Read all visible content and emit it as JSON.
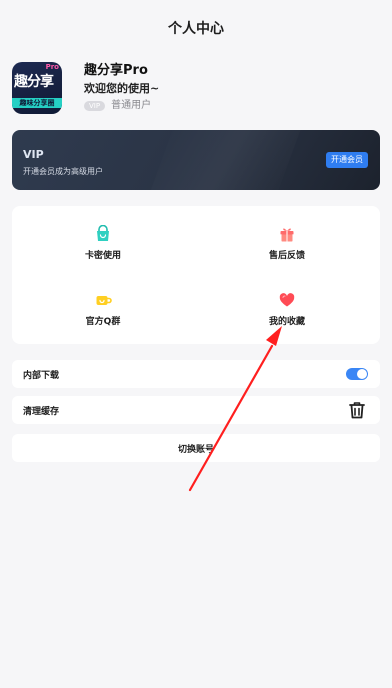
{
  "header": {
    "title": "个人中心"
  },
  "profile": {
    "logo_text": "趣分享",
    "logo_badge": "Pro",
    "logo_strip": "趣味分享圈",
    "name": "趣分享Pro",
    "greeting": "欢迎您的使用~",
    "vip_pill": "VIP",
    "level": "普通用户"
  },
  "vip_card": {
    "title": "VIP",
    "subtitle": "开通会员成为高级用户",
    "button": "开通会员"
  },
  "grid": {
    "items": [
      {
        "label": "卡密使用",
        "icon": "shopping-bag-icon",
        "color": "#2fd0c1"
      },
      {
        "label": "售后反馈",
        "icon": "gift-icon",
        "color": "#ff6b6b"
      },
      {
        "label": "官方Q群",
        "icon": "cup-icon",
        "color": "#ffcf22"
      },
      {
        "label": "我的收藏",
        "icon": "heart-icon",
        "color": "#ff4b55"
      }
    ]
  },
  "settings": {
    "internal_download": {
      "label": "内部下载",
      "enabled": true
    },
    "clear_cache": {
      "label": "清理缓存"
    },
    "switch_account": {
      "label": "切换账号"
    }
  },
  "colors": {
    "accent": "#3a86f5",
    "background": "#f6f6f8",
    "annotation_arrow": "#ff1f1f"
  }
}
